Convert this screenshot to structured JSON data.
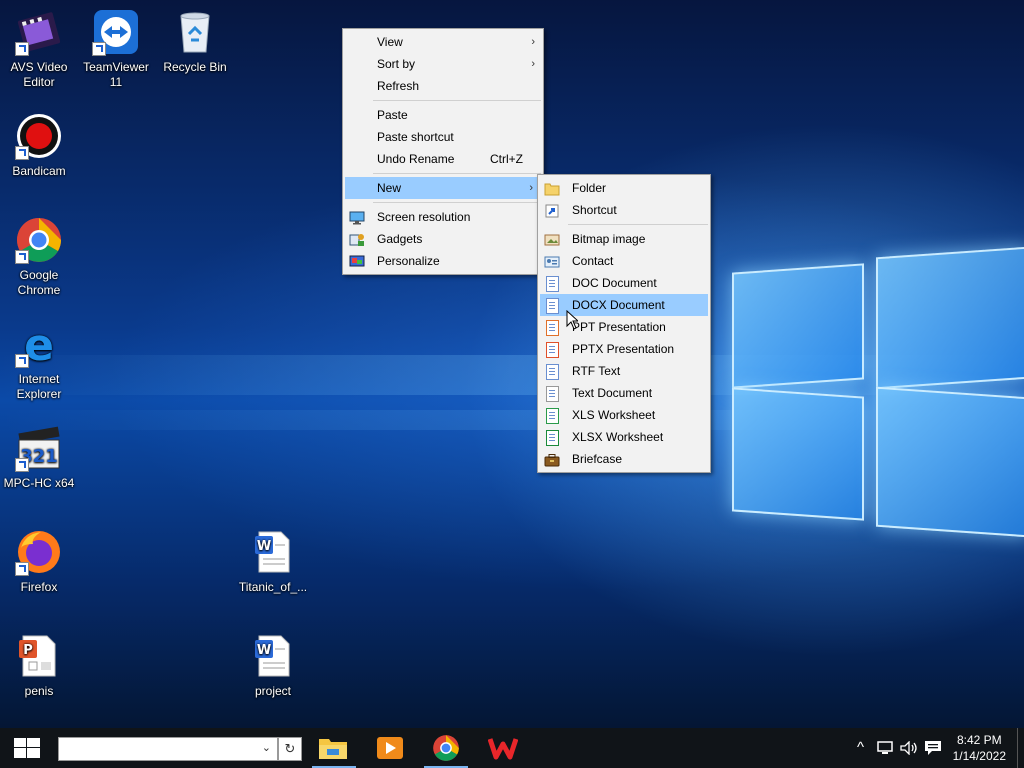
{
  "desktop_icons": [
    {
      "label": "AVS Video Editor"
    },
    {
      "label": "TeamViewer 11"
    },
    {
      "label": "Recycle Bin"
    },
    {
      "label": "Bandicam"
    },
    {
      "label": "Google Chrome"
    },
    {
      "label": "Internet Explorer"
    },
    {
      "label": "MPC-HC x64"
    },
    {
      "label": "Firefox"
    },
    {
      "label": "penis"
    },
    {
      "label": "Titanic_of_..."
    },
    {
      "label": "project"
    }
  ],
  "context_menu": {
    "view": "View",
    "sort_by": "Sort by",
    "refresh": "Refresh",
    "paste": "Paste",
    "paste_shortcut": "Paste shortcut",
    "undo_rename": "Undo Rename",
    "undo_rename_accel": "Ctrl+Z",
    "new": "New",
    "screen_resolution": "Screen resolution",
    "gadgets": "Gadgets",
    "personalize": "Personalize",
    "submenu_arrow": "›"
  },
  "new_submenu": {
    "folder": "Folder",
    "shortcut": "Shortcut",
    "bitmap": "Bitmap image",
    "contact": "Contact",
    "doc": "DOC Document",
    "docx": "DOCX Document",
    "ppt": "PPT Presentation",
    "pptx": "PPTX Presentation",
    "rtf": "RTF Text",
    "text": "Text Document",
    "xls": "XLS Worksheet",
    "xlsx": "XLSX Worksheet",
    "briefcase": "Briefcase"
  },
  "taskbar": {
    "search_value": "",
    "search_caret": "⌄",
    "refresh_glyph": "↻",
    "tray_chevron": "^",
    "time": "8:42 PM",
    "date": "1/14/2022"
  },
  "colors": {
    "menu_highlight": "#99ccff",
    "taskbar": "#101418",
    "accent": "#7ab4f0"
  }
}
